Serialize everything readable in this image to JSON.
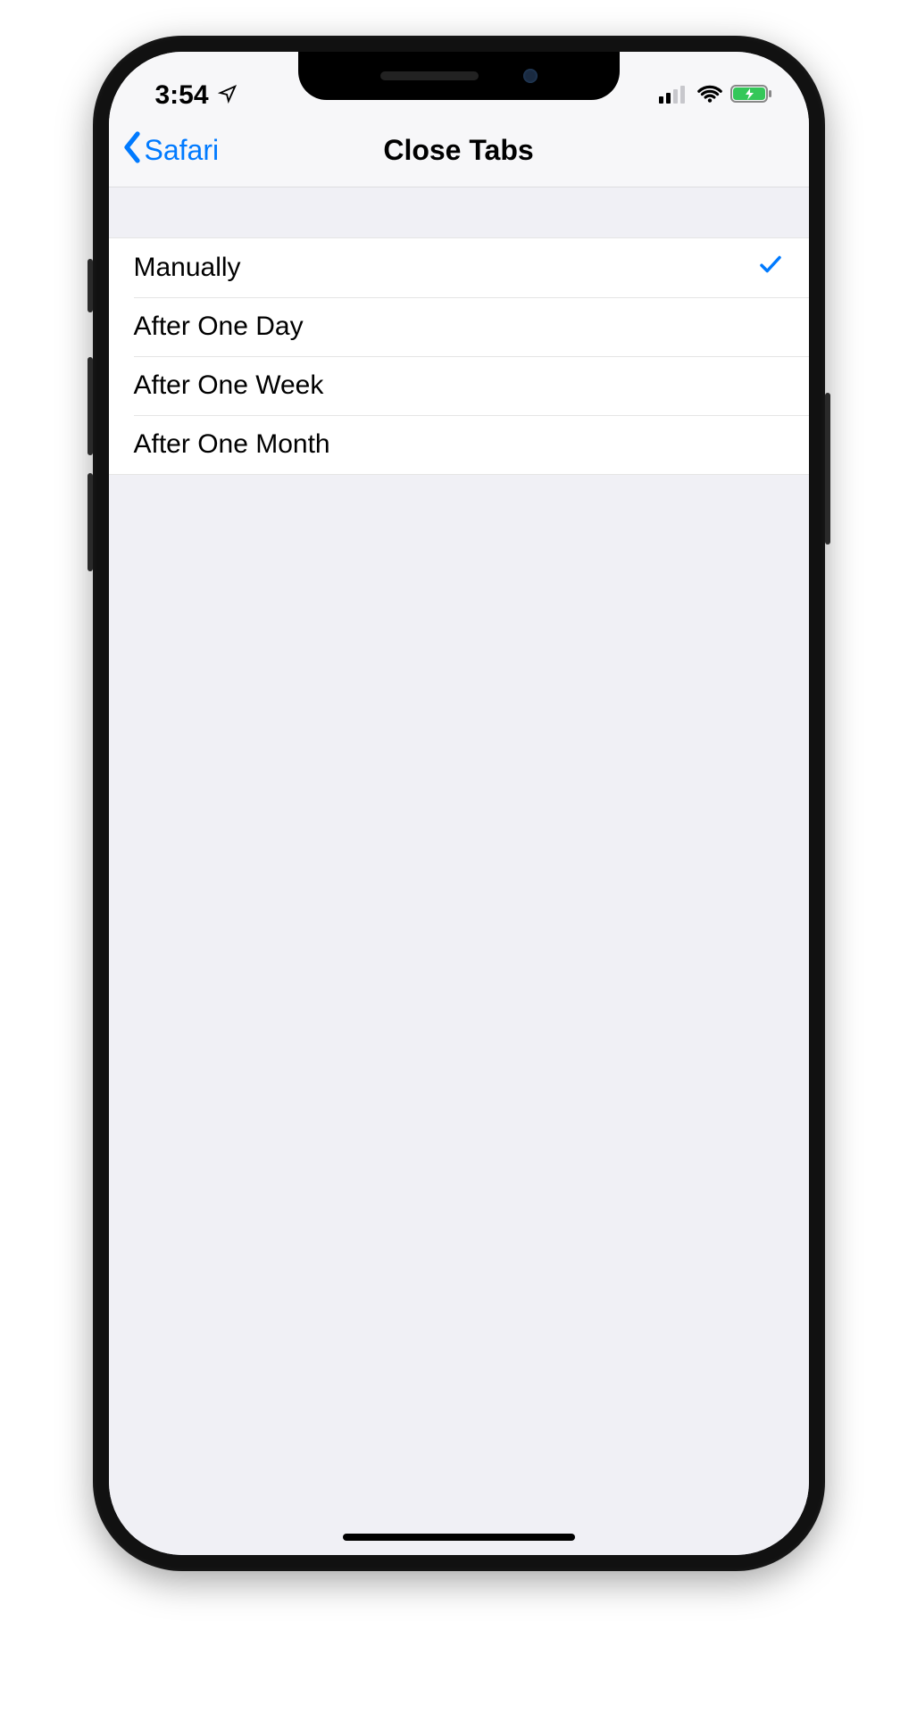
{
  "status": {
    "time": "3:54",
    "location_icon": "location-arrow-icon",
    "signal_bars_active": 2,
    "signal_bars_total": 4,
    "wifi_icon": "wifi-icon",
    "battery_charging": true,
    "battery_color": "#34c759"
  },
  "nav": {
    "back_label": "Safari",
    "title": "Close Tabs"
  },
  "options": [
    {
      "label": "Manually",
      "selected": true
    },
    {
      "label": "After One Day",
      "selected": false
    },
    {
      "label": "After One Week",
      "selected": false
    },
    {
      "label": "After One Month",
      "selected": false
    }
  ]
}
